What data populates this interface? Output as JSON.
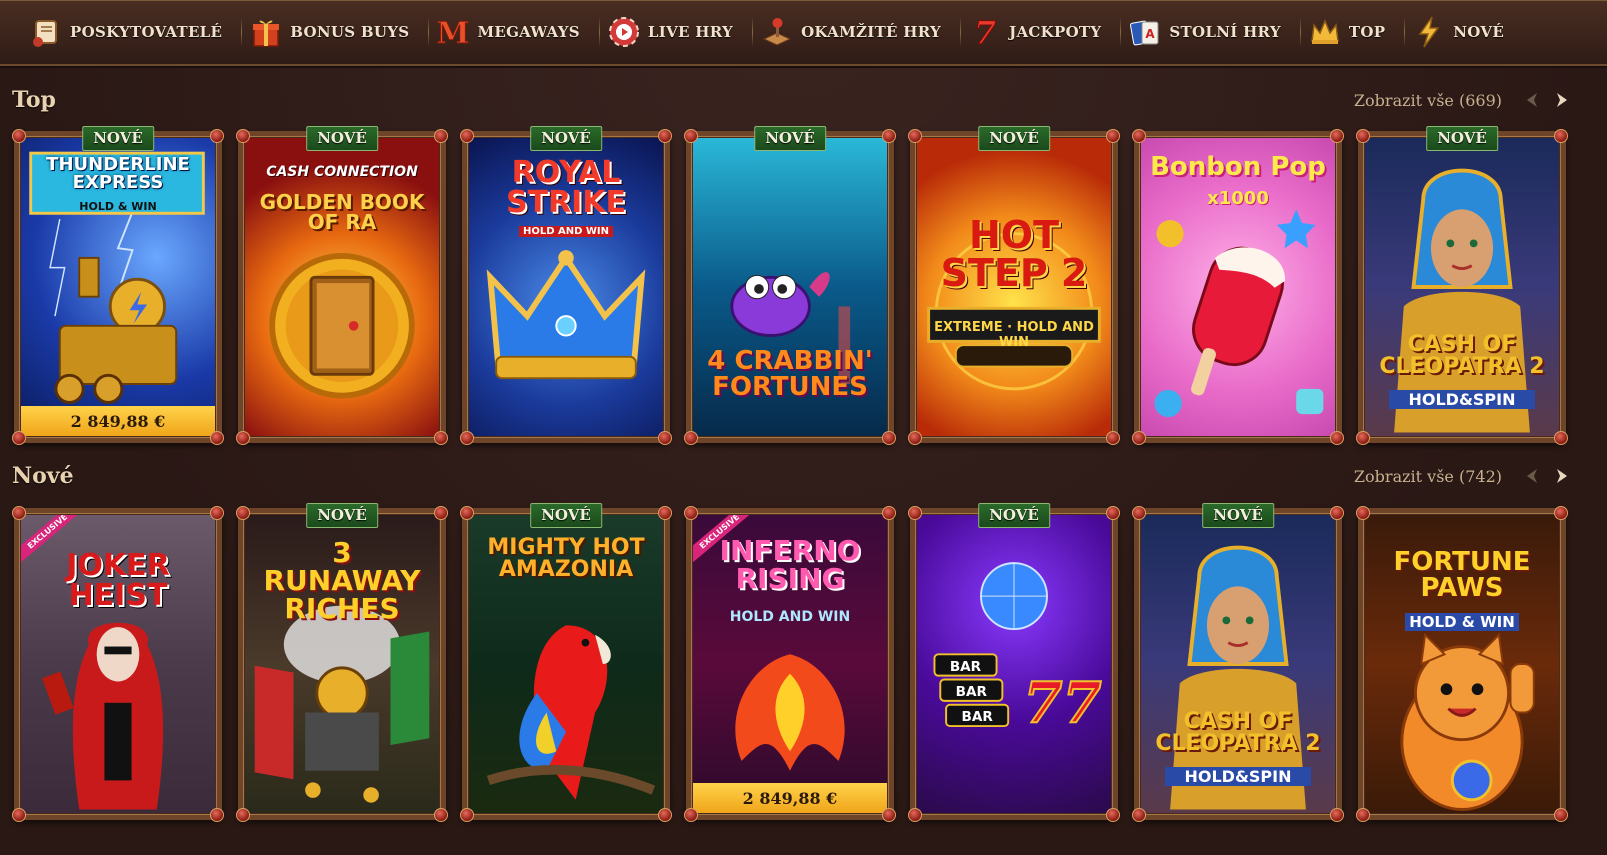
{
  "nav": {
    "items": [
      {
        "label": "POSKYTOVATELÉ",
        "icon": "scroll-icon"
      },
      {
        "label": "BONUS BUYS",
        "icon": "gift-icon"
      },
      {
        "label": "MEGAWAYS",
        "icon": "letter-m-icon"
      },
      {
        "label": "LIVE HRY",
        "icon": "live-chip-icon"
      },
      {
        "label": "OKAMŽITÉ HRY",
        "icon": "joystick-icon"
      },
      {
        "label": "JACKPOTY",
        "icon": "seven-icon"
      },
      {
        "label": "STOLNÍ HRY",
        "icon": "cards-icon"
      },
      {
        "label": "TOP",
        "icon": "crown-icon"
      },
      {
        "label": "NOVÉ",
        "icon": "lightning-icon"
      }
    ]
  },
  "sections": [
    {
      "title": "Top",
      "view_all": "Zobrazit vše (669)",
      "games": [
        {
          "title": "THUNDERLINE EXPRESS",
          "sub": "HOLD & WIN",
          "badge": "NOVÉ",
          "jackpot": "2 849,88 €",
          "exclusive": ""
        },
        {
          "title": "GOLDEN BOOK OF RA",
          "sub": "CASH CONNECTION",
          "badge": "NOVÉ",
          "jackpot": "",
          "exclusive": ""
        },
        {
          "title": "ROYAL STRIKE",
          "sub": "HOLD AND WIN",
          "badge": "NOVÉ",
          "jackpot": "",
          "exclusive": ""
        },
        {
          "title": "4 CRABBIN' FORTUNES",
          "sub": "",
          "badge": "NOVÉ",
          "jackpot": "",
          "exclusive": ""
        },
        {
          "title": "HOT STEP 2",
          "sub": "EXTREME · HOLD AND WIN",
          "badge": "NOVÉ",
          "jackpot": "",
          "exclusive": ""
        },
        {
          "title": "Bonbon Pop",
          "sub": "x1000",
          "badge": "",
          "jackpot": "",
          "exclusive": ""
        },
        {
          "title": "CASH OF CLEOPATRA 2",
          "sub": "HOLD&SPIN",
          "badge": "NOVÉ",
          "jackpot": "",
          "exclusive": ""
        }
      ]
    },
    {
      "title": "Nové",
      "view_all": "Zobrazit vše (742)",
      "games": [
        {
          "title": "JOKER HEIST",
          "sub": "",
          "badge": "",
          "jackpot": "",
          "exclusive": "EXCLUSIVE"
        },
        {
          "title": "3 RUNAWAY RICHES",
          "sub": "",
          "badge": "NOVÉ",
          "jackpot": "",
          "exclusive": ""
        },
        {
          "title": "MIGHTY HOT AMAZONIA",
          "sub": "",
          "badge": "NOVÉ",
          "jackpot": "",
          "exclusive": ""
        },
        {
          "title": "INFERNO RISING",
          "sub": "HOLD AND WIN",
          "badge": "",
          "jackpot": "2 849,88 €",
          "exclusive": "EXCLUSIVE"
        },
        {
          "title": "BAR BAR BAR 777",
          "sub": "",
          "badge": "NOVÉ",
          "jackpot": "",
          "exclusive": ""
        },
        {
          "title": "CASH OF CLEOPATRA 2",
          "sub": "HOLD&SPIN",
          "badge": "NOVÉ",
          "jackpot": "",
          "exclusive": ""
        },
        {
          "title": "FORTUNE PAWS",
          "sub": "HOLD & WIN",
          "badge": "",
          "jackpot": "",
          "exclusive": ""
        }
      ]
    }
  ]
}
